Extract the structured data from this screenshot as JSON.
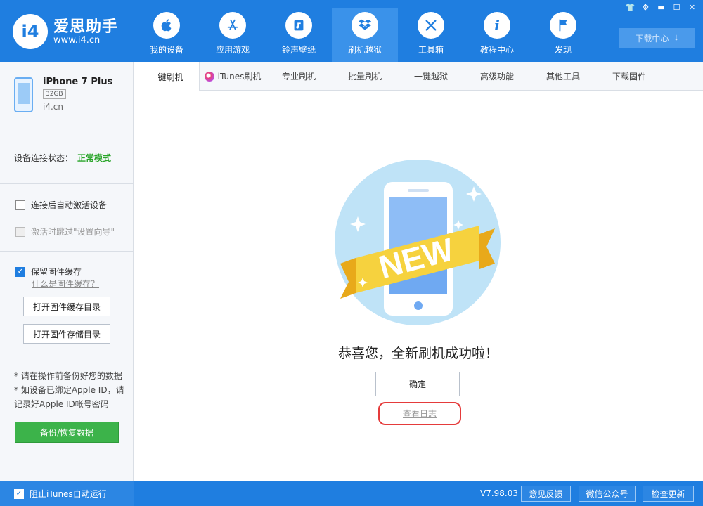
{
  "brand": {
    "logo_text": "i4",
    "name": "爱思助手",
    "url": "www.i4.cn"
  },
  "nav": [
    {
      "label": "我的设备",
      "icon": "apple-icon"
    },
    {
      "label": "应用游戏",
      "icon": "app-store-icon"
    },
    {
      "label": "铃声壁纸",
      "icon": "music-icon"
    },
    {
      "label": "刷机越狱",
      "icon": "dropbox-icon",
      "active": true
    },
    {
      "label": "工具箱",
      "icon": "tools-icon"
    },
    {
      "label": "教程中心",
      "icon": "info-icon"
    },
    {
      "label": "发现",
      "icon": "flag-icon"
    }
  ],
  "window_controls": [
    "shirt-icon",
    "gear-icon",
    "minimize-icon",
    "maximize-icon",
    "close-icon"
  ],
  "download_center": {
    "label": "下载中心",
    "icon": "download-icon"
  },
  "device": {
    "name": "iPhone 7 Plus",
    "capacity": "32GB",
    "host": "i4.cn"
  },
  "status": {
    "label": "设备连接状态：",
    "value": "正常模式"
  },
  "options": {
    "auto_activate": {
      "label": "连接后自动激活设备",
      "checked": false
    },
    "skip_setup": {
      "label": "激活时跳过\"设置向导\"",
      "checked": false,
      "disabled": true
    },
    "keep_cache": {
      "label": "保留固件缓存",
      "checked": true
    },
    "cache_help": "什么是固件缓存？"
  },
  "sidebar_buttons": {
    "open_cache_dir": "打开固件缓存目录",
    "open_storage_dir": "打开固件存储目录"
  },
  "notes": [
    "* 请在操作前备份好您的数据",
    "* 如设备已绑定Apple ID，请记录好Apple ID帐号密码"
  ],
  "backup_button": "备份/恢复数据",
  "tabs": [
    "一键刷机",
    "iTunes刷机",
    "专业刷机",
    "批量刷机",
    "一键越狱",
    "高级功能",
    "其他工具",
    "下载固件"
  ],
  "main": {
    "badge_text": "NEW",
    "success_message": "恭喜您，全新刷机成功啦！",
    "confirm_button": "确定",
    "view_log_link": "查看日志"
  },
  "footer": {
    "block_itunes": {
      "label": "阻止iTunes自动运行",
      "checked": true
    },
    "version": "V7.98.03",
    "feedback": "意见反馈",
    "wechat": "微信公众号",
    "check_update": "检查更新"
  },
  "colors": {
    "primary": "#1f7ee0",
    "success_green": "#2aa52a",
    "button_green": "#3cb34a",
    "highlight_red": "#e53b3b",
    "ribbon_yellow": "#f6d23e"
  }
}
